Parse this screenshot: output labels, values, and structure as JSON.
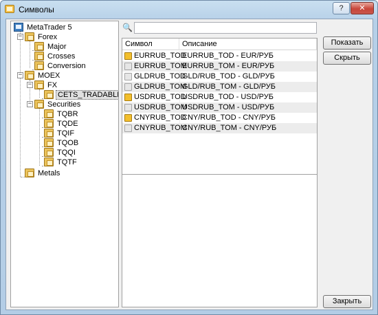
{
  "window": {
    "title": "Символы",
    "help_label": "?",
    "close_label": "✕"
  },
  "tree": {
    "root": "MetaTrader 5",
    "forex": "Forex",
    "major": "Major",
    "crosses": "Crosses",
    "conversion": "Conversion",
    "moex": "MOEX",
    "fx": "FX",
    "cets": "CETS_TRADABLE",
    "securities": "Securities",
    "tqbr": "TQBR",
    "tqde": "TQDE",
    "tqif": "TQIF",
    "tqob": "TQOB",
    "tqqi": "TQQI",
    "tqtf": "TQTF",
    "metals": "Metals",
    "expander_open": "−"
  },
  "search": {
    "value": "",
    "icon": "binoculars-icon"
  },
  "table": {
    "headers": {
      "symbol": "Символ",
      "description": "Описание"
    },
    "rows": [
      {
        "symbol": "EURRUB_TOD",
        "description": "EURRUB_TOD - EUR/РУБ",
        "active": true
      },
      {
        "symbol": "EURRUB_TOM",
        "description": "EURRUB_TOM - EUR/РУБ",
        "active": false
      },
      {
        "symbol": "GLDRUB_TOD",
        "description": "GLD/RUB_TOD - GLD/РУБ",
        "active": false
      },
      {
        "symbol": "GLDRUB_TOM",
        "description": "GLD/RUB_TOM - GLD/РУБ",
        "active": false
      },
      {
        "symbol": "USDRUB_TOD",
        "description": "USDRUB_TOD - USD/РУБ",
        "active": true
      },
      {
        "symbol": "USDRUB_TOM",
        "description": "USDRUB_TOM - USD/РУБ",
        "active": false
      },
      {
        "symbol": "CNYRUB_TOD",
        "description": "CNY/RUB_TOD - CNY/РУБ",
        "active": true
      },
      {
        "symbol": "CNYRUB_TOM",
        "description": "CNY/RUB_TOM - CNY/РУБ",
        "active": false
      }
    ]
  },
  "buttons": {
    "show": "Показать",
    "hide": "Скрыть",
    "close": "Закрыть"
  },
  "colors": {
    "active_symbol": "#f3bf2c",
    "title_gradient": "#c9dff0"
  }
}
